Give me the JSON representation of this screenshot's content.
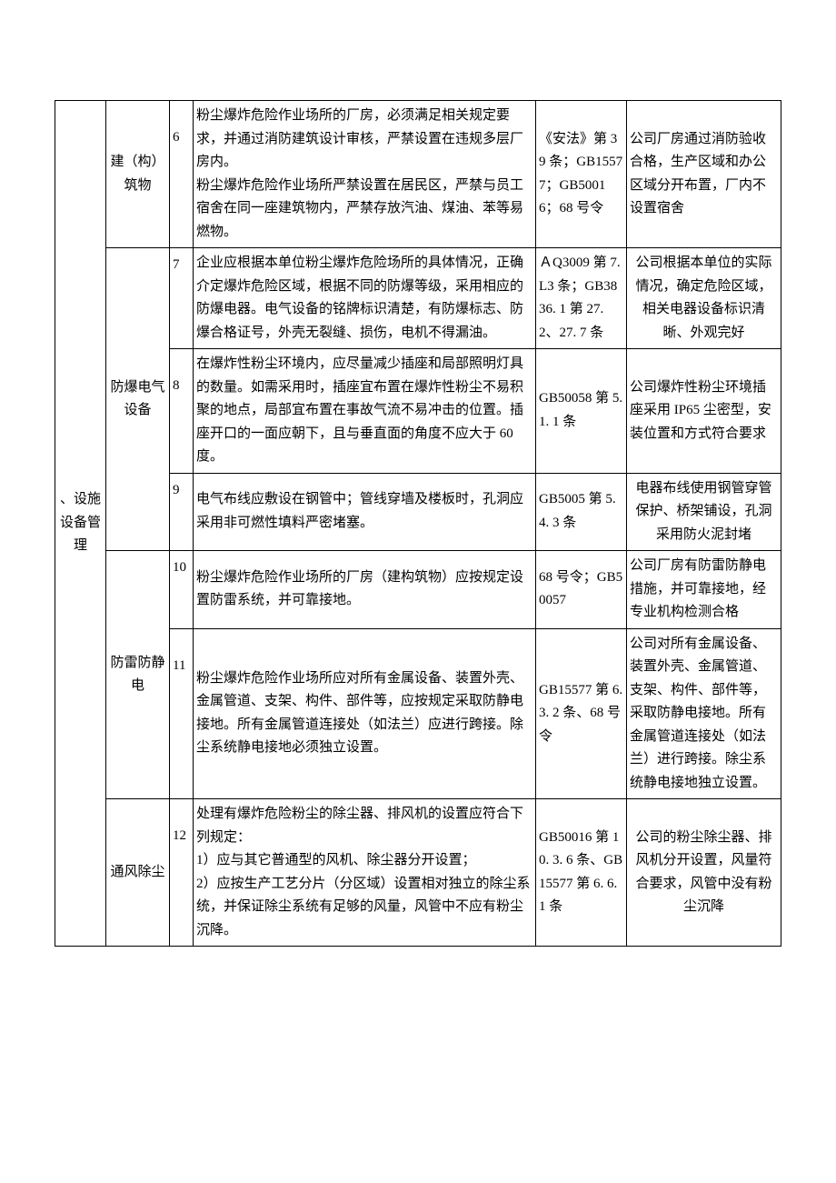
{
  "category": "、设施设备管理",
  "rows": [
    {
      "subcat": "建（构）筑物",
      "num": "6",
      "req": "粉尘爆炸危险作业场所的厂房，必须满足相关规定要求，并通过消防建筑设计审核，严禁设置在违规多层厂房内。\n粉尘爆炸危险作业场所严禁设置在居民区，严禁与员工宿舍在同一座建筑物内，严禁存放汽油、煤油、苯等易燃物。",
      "ref": "《安法》第 39 条；GB15577；GB50016；68 号令",
      "status": "公司厂房通过消防验收合格，生产区域和办公区域分开布置，厂内不设置宿舍"
    },
    {
      "subcat": "防爆电气设备",
      "subcat_rowspan": 3,
      "num": "7",
      "req": "企业应根据本单位粉尘爆炸危险场所的具体情况，正确介定爆炸危险区域，根据不同的防爆等级，采用相应的防爆电器。电气设备的铭牌标识清楚，有防爆标志、防爆合格证号，外壳无裂缝、损伤，电机不得漏油。",
      "ref": "ＡQ3009 第 7. L3 条；GB3836. 1 第 27. 2、27. 7 条",
      "status": "公司根据本单位的实际情况，确定危险区域，相关电器设备标识清晰、外观完好"
    },
    {
      "num": "8",
      "req": "在爆炸性粉尘环境内，应尽量减少插座和局部照明灯具的数量。如需采用时，插座宜布置在爆炸性粉尘不易积聚的地点，局部宜布置在事故气流不易冲击的位置。插座开口的一面应朝下，且与垂直面的角度不应大于 60 度。",
      "ref": "GB50058 第 5. 1. 1 条",
      "status": "公司爆炸性粉尘环境插座采用 IP65 尘密型，安装位置和方式符合要求",
      "status_align": "left"
    },
    {
      "num": "9",
      "req": "电气布线应敷设在钢管中；管线穿墙及楼板时，孔洞应采用非可燃性填料严密堵塞。",
      "ref": "GB5005 第 5. 4. 3 条",
      "status": "电器布线使用钢管穿管保护、桥架铺设，孔洞采用防火泥封堵"
    },
    {
      "subcat": "防雷防静电",
      "subcat_rowspan": 2,
      "num": "10",
      "req": "粉尘爆炸危险作业场所的厂房（建构筑物）应按规定设置防雷系统，并可靠接地。",
      "ref": "68 号令；GB50057",
      "status": "公司厂房有防雷防静电措施，并可靠接地，经专业机构检测合格",
      "status_align": "left"
    },
    {
      "num": "11",
      "req": "粉尘爆炸危险作业场所应对所有金属设备、装置外壳、金属管道、支架、构件、部件等，应按规定采取防静电接地。所有金属管道连接处（如法兰）应进行跨接。除尘系统静电接地必须独立设置。",
      "ref": "GB15577 第 6. 3. 2 条、68 号令",
      "status": "公司对所有金属设备、装置外壳、金属管道、支架、构件、部件等，采取防静电接地。所有金属管道连接处（如法兰）进行跨接。除尘系统静电接地独立设置。",
      "status_align": "left"
    },
    {
      "subcat": "通风除尘",
      "num": "12",
      "req": "处理有爆炸危险粉尘的除尘器、排风机的设置应符合下列规定：\n1）应与其它普通型的风机、除尘器分开设置；\n2）应按生产工艺分片（分区域）设置相对独立的除尘系统，并保证除尘系统有足够的风量，风管中不应有粉尘沉降。",
      "ref": "GB50016 第 10. 3. 6 条、GB15577 第 6. 6. 1 条",
      "status": "公司的粉尘除尘器、排风机分开设置，风量符合要求，风管中没有粉尘沉降"
    }
  ]
}
